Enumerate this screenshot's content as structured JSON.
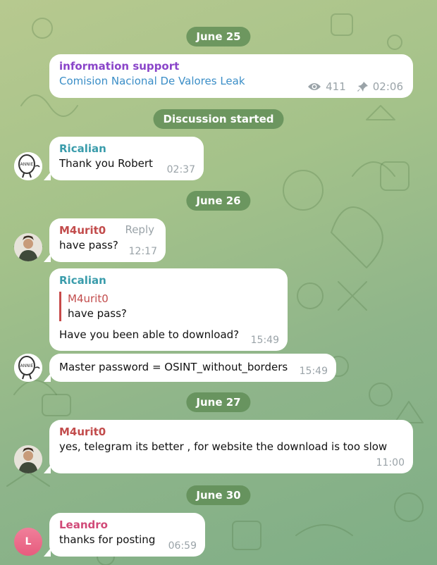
{
  "colors": {
    "channel_name": "#8a45c9",
    "link": "#3b8ec7",
    "ricalian": "#3a9cab",
    "m4urit0": "#c24c4c",
    "leandro": "#d14a78",
    "date_pill": "#5f8c55"
  },
  "dates": {
    "june25": "June 25",
    "discussion": "Discussion started",
    "june26": "June 26",
    "june27": "June 27",
    "june30": "June 30"
  },
  "post": {
    "channel": "information support",
    "title": "Comision Nacional De Valores Leak",
    "views": "411",
    "time": "02:06",
    "views_icon": "eye-icon",
    "pin_icon": "pin-icon"
  },
  "messages": [
    {
      "sender": "Ricalian",
      "text": "Thank you Robert",
      "time": "02:37"
    },
    {
      "sender": "M4urit0",
      "text": "have pass?",
      "time": "12:17",
      "reply_label": "Reply"
    },
    {
      "sender": "Ricalian",
      "quote_sender": "M4urit0",
      "quote_text": "have pass?",
      "text": "Have you been able to download?",
      "time": "15:49"
    },
    {
      "text": "Master password = OSINT_without_borders",
      "time": "15:49"
    },
    {
      "sender": "M4urit0",
      "text": "yes, telegram its better , for website the download is too slow",
      "time": "11:00"
    },
    {
      "sender": "Leandro",
      "text": "thanks for posting",
      "time": "06:59",
      "avatar_letter": "L"
    }
  ]
}
